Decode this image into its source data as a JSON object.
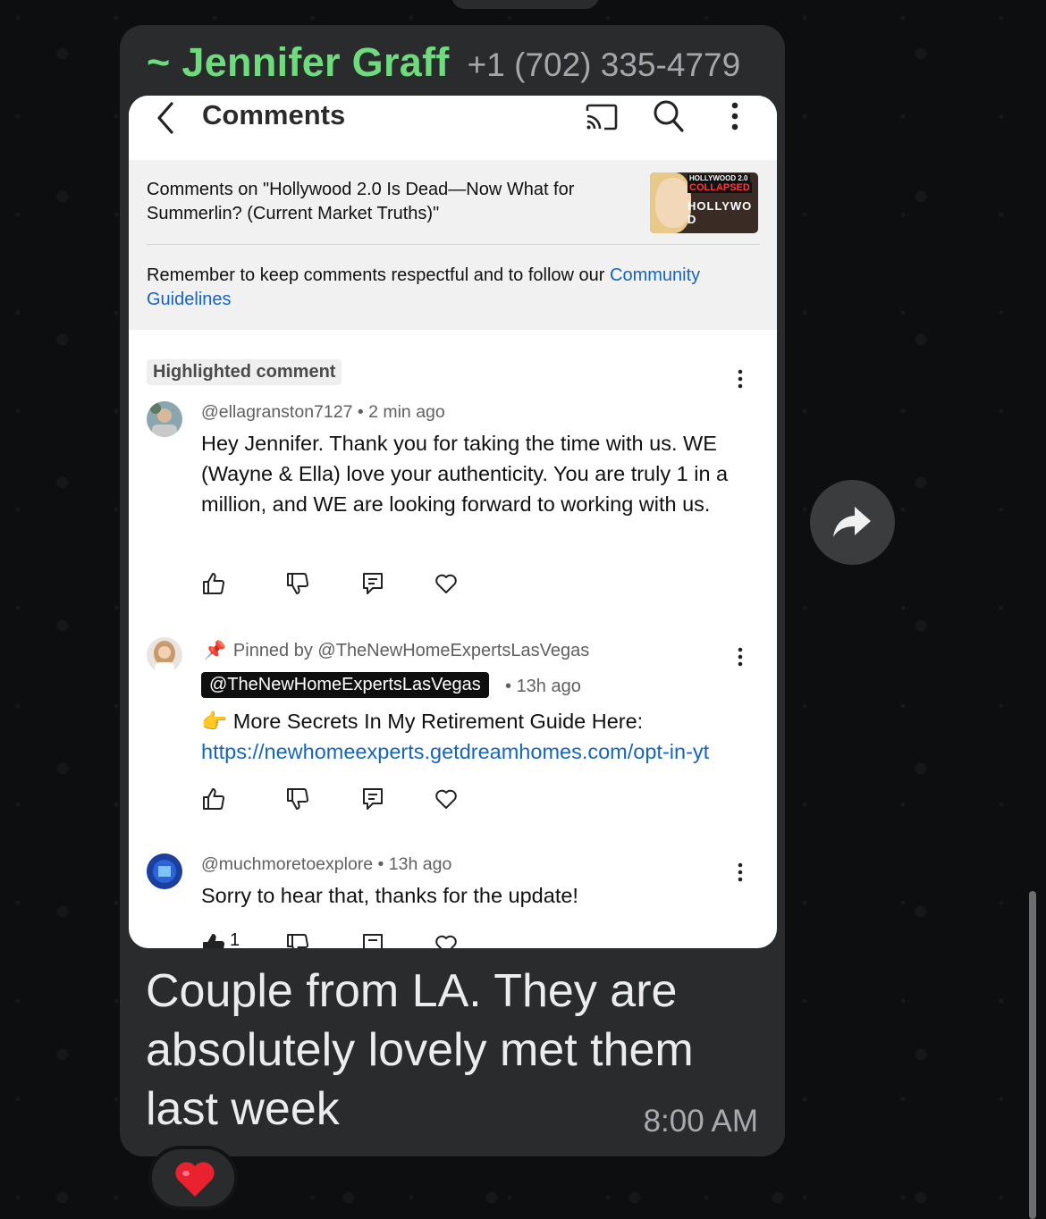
{
  "chat": {
    "sender_name": "~ Jennifer Graff",
    "sender_phone": "+1 (702) 335-4779",
    "message_text": "Couple from LA.  They are absolutely lovely met them last week",
    "time": "8:00 AM",
    "reaction": "❤️",
    "accent_color": "#6edb7d"
  },
  "screenshot": {
    "appbar": {
      "title": "Comments",
      "icons": [
        "back-icon",
        "cast-icon",
        "search-icon",
        "more-icon"
      ]
    },
    "video": {
      "title": "Comments on \"Hollywood 2.0 Is Dead—Now What for Summerlin? (Current Market Truths)\"",
      "thumbnail_text_1": "HOLLYWOOD 2.0",
      "thumbnail_text_2": "COLLAPSED",
      "thumbnail_text_3": "HOLLYWO D"
    },
    "reminder": {
      "text": "Remember to keep comments respectful and to follow our ",
      "link_text": "Community Guidelines",
      "link_color": "#1565c0"
    },
    "highlighted_label": "Highlighted comment",
    "comments": [
      {
        "author": "@ellagranston7127",
        "time": "2 min ago",
        "text": "Hey Jennifer.  Thank you for taking the time with us.  WE (Wayne & Ella) love your authenticity. You are truly 1 in a million, and WE are looking forward to working with us."
      },
      {
        "pinned_by": "Pinned by @TheNewHomeExpertsLasVegas",
        "author": "@TheNewHomeExpertsLasVegas",
        "time": "13h ago",
        "emoji": "👉",
        "text": "More Secrets In My Retirement Guide Here: ",
        "link": "https://newhomeexperts.getdreamhomes.com/opt-in-yt"
      },
      {
        "author": "@muchmoretoexplore",
        "time": "13h ago",
        "text": "Sorry to hear that, thanks for the update!",
        "likes": "1"
      }
    ]
  }
}
